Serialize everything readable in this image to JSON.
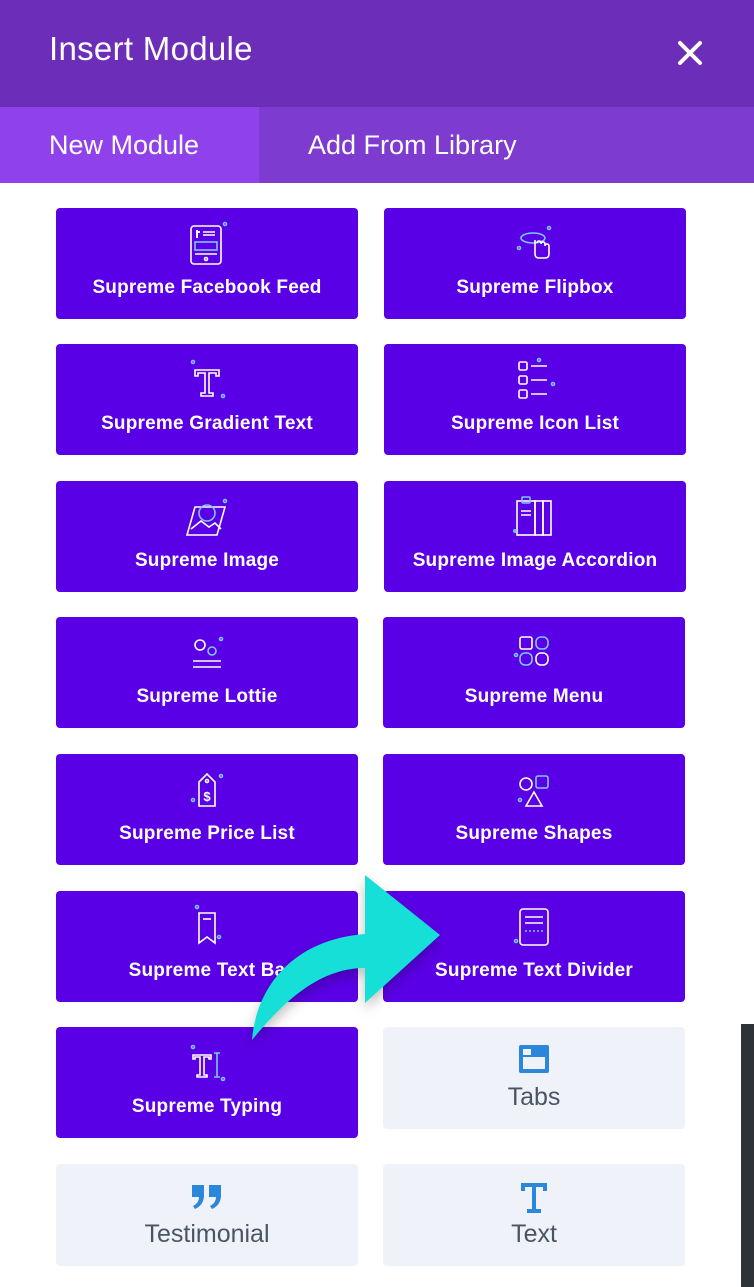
{
  "header": {
    "title": "Insert Module",
    "close_icon": "close-icon"
  },
  "tabs": [
    {
      "label": "New Module",
      "active": true
    },
    {
      "label": "Add From Library",
      "active": false
    }
  ],
  "modules": [
    {
      "label": "Supreme Facebook Feed",
      "icon": "facebook-feed-icon"
    },
    {
      "label": "Supreme Flipbox",
      "icon": "flipbox-icon"
    },
    {
      "label": "Supreme Gradient Text",
      "icon": "gradient-text-icon"
    },
    {
      "label": "Supreme Icon List",
      "icon": "icon-list-icon"
    },
    {
      "label": "Supreme Image",
      "icon": "image-icon"
    },
    {
      "label": "Supreme Image Accordion",
      "icon": "image-accordion-icon"
    },
    {
      "label": "Supreme Lottie",
      "icon": "lottie-icon"
    },
    {
      "label": "Supreme Menu",
      "icon": "menu-icon"
    },
    {
      "label": "Supreme Price List",
      "icon": "price-list-icon"
    },
    {
      "label": "Supreme Shapes",
      "icon": "shapes-icon"
    },
    {
      "label": "Supreme Text Ba",
      "icon": "text-badge-icon"
    },
    {
      "label": "Supreme Text Divider",
      "icon": "text-divider-icon"
    },
    {
      "label": "Supreme Typing",
      "icon": "typing-icon"
    },
    {
      "label": "Tabs",
      "icon": "tabs-icon"
    },
    {
      "label": "Testimonial",
      "icon": "quote-icon"
    },
    {
      "label": "Text",
      "icon": "text-icon"
    }
  ],
  "colors": {
    "header": "#6c2eb9",
    "tab_bar": "#7e3bd0",
    "tab_active": "#8f42ec",
    "module_purple": "#5a00e6",
    "module_grey": "#eff2f8",
    "arrow": "#15dfd8",
    "icon_blue": "#2b87da"
  },
  "overlay": {
    "arrow": "curved-arrow-icon"
  }
}
